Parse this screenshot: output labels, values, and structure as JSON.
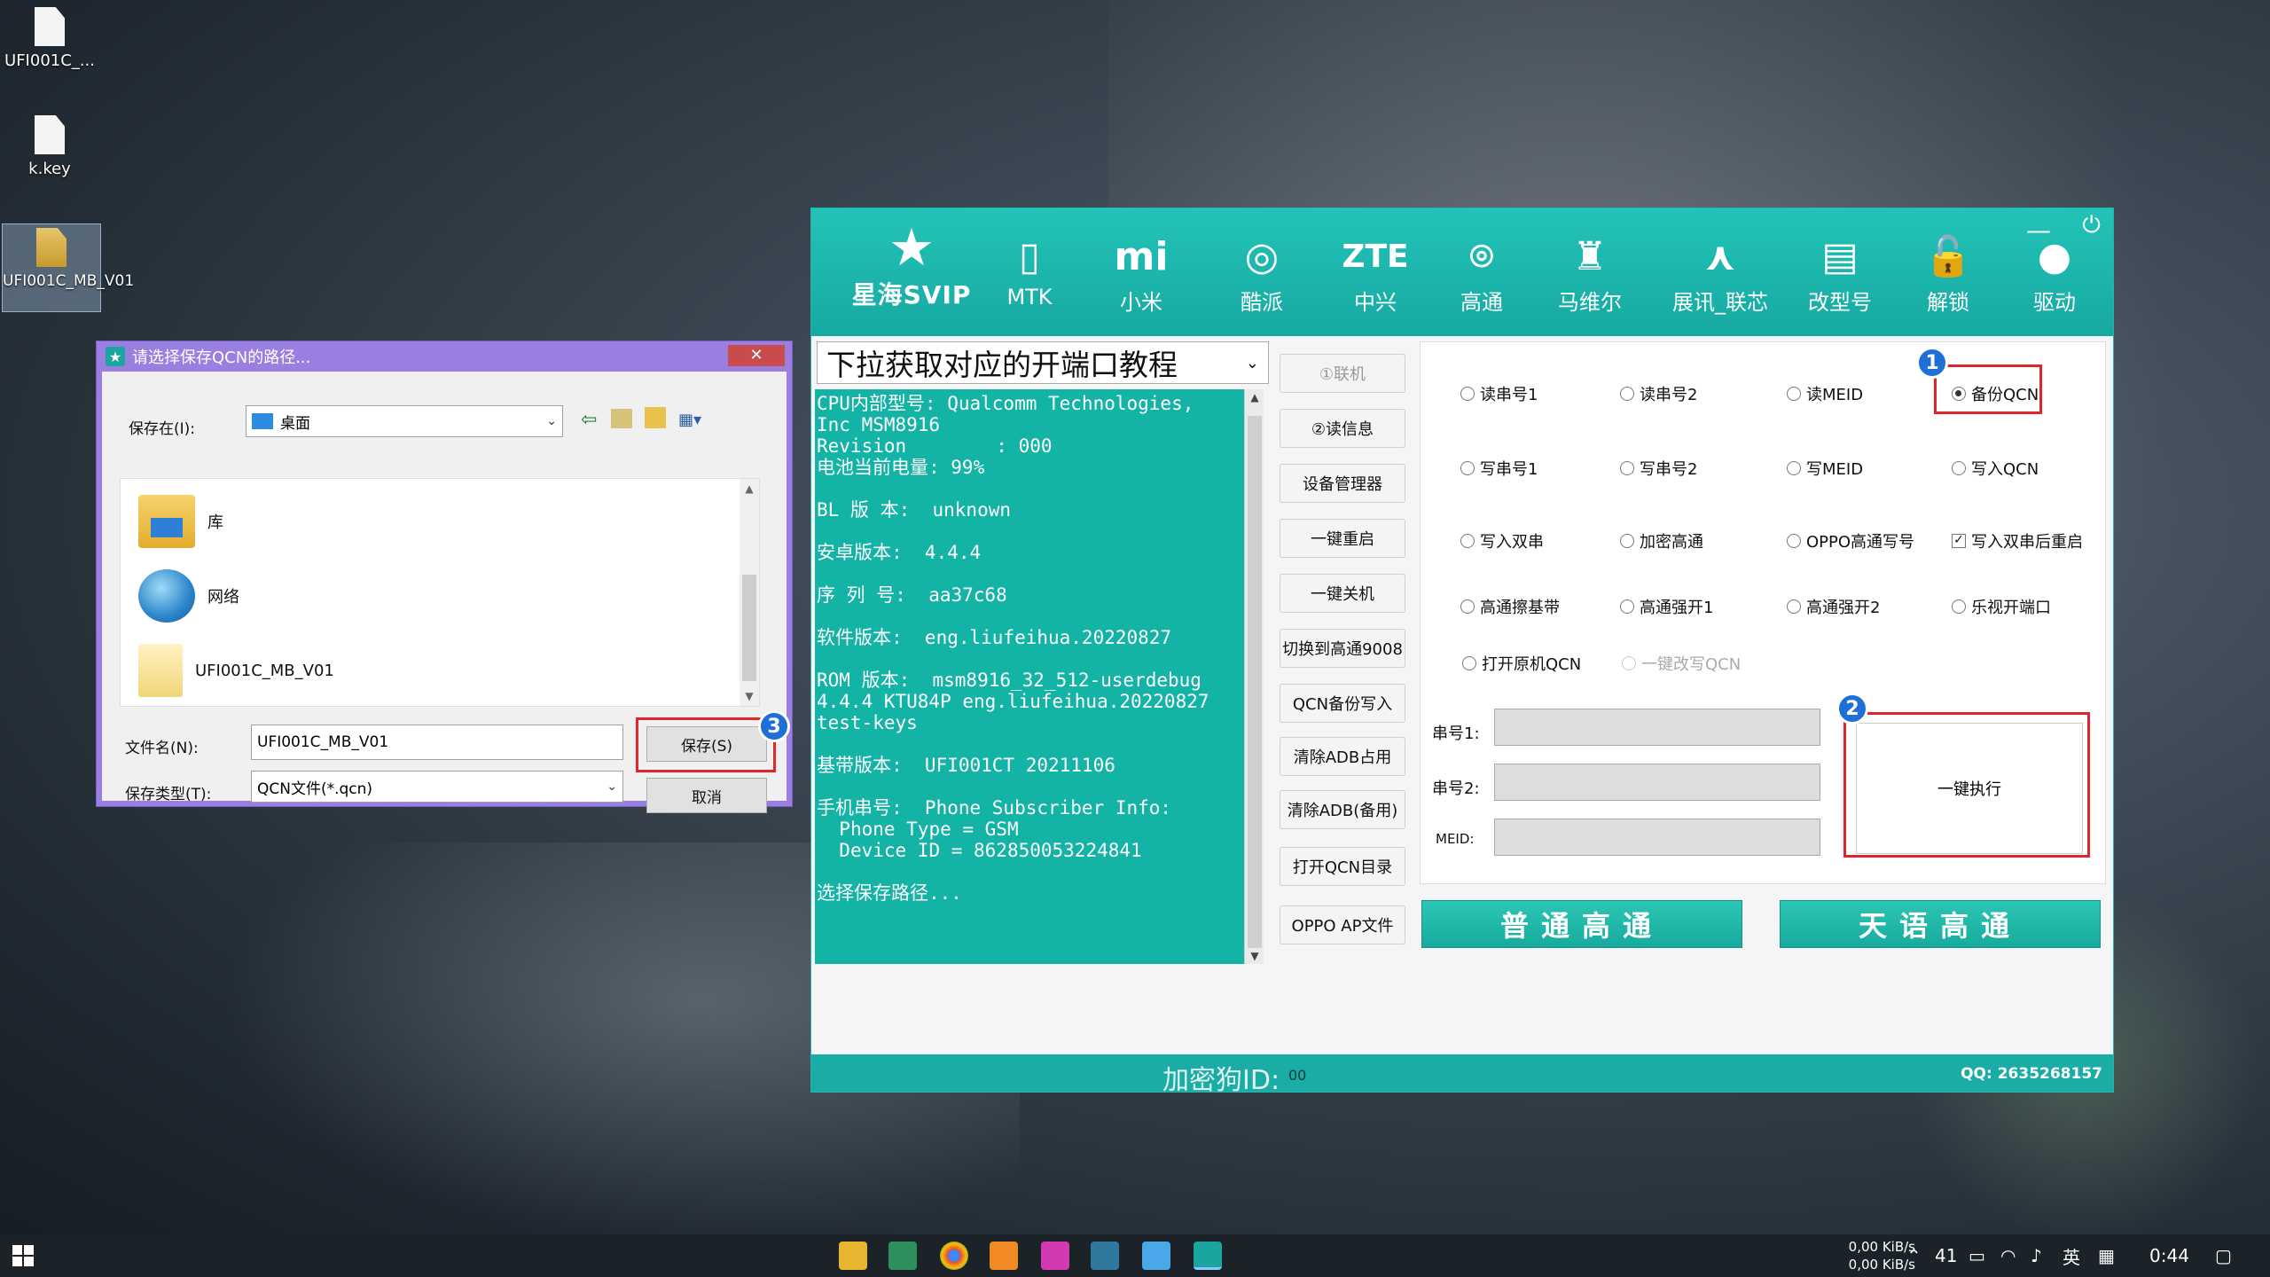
{
  "desktop": {
    "icons": [
      {
        "label": "UFI001C_..."
      },
      {
        "label": "k.key"
      },
      {
        "label": "UFI001C_MB_V01"
      }
    ]
  },
  "save_dialog": {
    "title": "请选择保存QCN的路径...",
    "close": "✕",
    "save_in_label": "保存在(I):",
    "save_in_value": "桌面",
    "items": [
      {
        "label": "库"
      },
      {
        "label": "网络"
      },
      {
        "label": "UFI001C_MB_V01"
      }
    ],
    "filename_label": "文件名(N):",
    "filename_value": "UFI001C_MB_V01",
    "filetype_label": "保存类型(T):",
    "filetype_value": "QCN文件(*.qcn)",
    "save_button": "保存(S)",
    "cancel_button": "取消",
    "badge": "3"
  },
  "app": {
    "logo_text": "星海SVIP",
    "brands": [
      {
        "label": "MTK",
        "glyph": "▯"
      },
      {
        "label": "小米",
        "glyph": "mi"
      },
      {
        "label": "酷派",
        "glyph": "◎"
      },
      {
        "label": "中兴",
        "glyph": "ZTE"
      },
      {
        "label": "高通",
        "glyph": "⌾"
      },
      {
        "label": "马维尔",
        "glyph": "♜"
      },
      {
        "label": "展讯_联芯",
        "glyph": "⋏"
      },
      {
        "label": "改型号",
        "glyph": "▤"
      },
      {
        "label": "解锁",
        "glyph": "🔓"
      },
      {
        "label": "驱动",
        "glyph": "●"
      }
    ],
    "minimize": "—",
    "power": "⏻",
    "tutorial_select": "下拉获取对应的开端口教程",
    "console_lines": [
      "CPU内部型号: Qualcomm Technologies,",
      "Inc MSM8916",
      "Revision        : 000",
      "电池当前电量: 99%",
      "",
      "BL 版 本:  unknown",
      "",
      "安卓版本:  4.4.4",
      "",
      "序 列 号:  aa37c68",
      "",
      "软件版本:  eng.liufeihua.20220827",
      "",
      "ROM 版本:  msm8916_32_512-userdebug",
      "4.4.4 KTU84P eng.liufeihua.20220827",
      "test-keys",
      "",
      "基带版本:  UFI001CT 20211106",
      "",
      "手机串号:  Phone Subscriber Info:",
      "  Phone Type = GSM",
      "  Device ID = 862850053224841",
      "",
      "选择保存路径..."
    ],
    "action_buttons": [
      {
        "label": "①联机",
        "dim": true
      },
      {
        "label": "②读信息"
      },
      {
        "label": "设备管理器"
      },
      {
        "label": "一键重启"
      },
      {
        "label": "一键关机"
      },
      {
        "label": "切换到高通9008"
      },
      {
        "label": "QCN备份写入"
      },
      {
        "label": "清除ADB占用"
      },
      {
        "label": "清除ADB(备用)"
      },
      {
        "label": "打开QCN目录"
      },
      {
        "label": "OPPO AP文件"
      }
    ],
    "options": {
      "r1": [
        "读串号1",
        "读串号2",
        "读MEID",
        "备份QCN"
      ],
      "r2": [
        "写串号1",
        "写串号2",
        "写MEID",
        "写入QCN"
      ],
      "r3": [
        "写入双串",
        "加密高通",
        "OPPO高通写号",
        "写入双串后重启"
      ],
      "r4": [
        "高通擦基带",
        "高通强开1",
        "高通强开2",
        "乐视开端口"
      ],
      "r5": [
        "打开原机QCN",
        "一键改写QCN"
      ]
    },
    "serial_labels": [
      "串号1:",
      "串号2:",
      "MEID:"
    ],
    "exec_button": "一键执行",
    "badge1": "1",
    "badge2": "2",
    "normal_qualcomm": "普通高通",
    "tianyu_qualcomm": "天语高通",
    "footer_id_label": "加密狗ID:",
    "footer_id_value": "00",
    "footer_qq": "QQ: 2635268157"
  },
  "taskbar": {
    "net_up": "0,00 KiB/s",
    "net_down": "0,00 KiB/s",
    "temp": "41",
    "ime": "英",
    "clock": "0:44"
  }
}
